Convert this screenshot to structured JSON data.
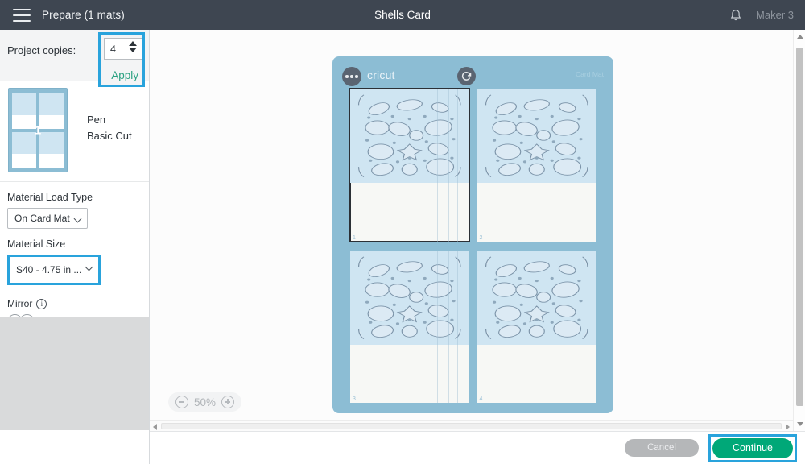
{
  "topbar": {
    "menu_icon": "hamburger-icon",
    "left_title": "Prepare (1 mats)",
    "center_title": "Shells Card",
    "bell_icon": "bell-icon",
    "machine_name": "Maker 3"
  },
  "sidebar": {
    "copies": {
      "label": "Project copies:",
      "value": "4",
      "apply_label": "Apply",
      "highlight_color": "#29a3dc"
    },
    "mat_thumbnail": {
      "number": "1",
      "operations": [
        "Pen",
        "Basic Cut"
      ]
    },
    "material_load_type": {
      "label": "Material Load Type",
      "value": "On Card Mat"
    },
    "material_size": {
      "label": "Material Size",
      "value": "S40 - 4.75 in ...",
      "highlight_color": "#29a3dc"
    },
    "mirror": {
      "label": "Mirror",
      "info_icon": "info-icon",
      "toggle_state": "off"
    }
  },
  "canvas": {
    "mat": {
      "more_icon": "more-options-icon",
      "brand": "cricut",
      "corner_label": "Card Mat",
      "rotate_icon": "rotate-icon",
      "cards": [
        {
          "number": "1",
          "selected": true
        },
        {
          "number": "2",
          "selected": false
        },
        {
          "number": "3",
          "selected": false
        },
        {
          "number": "4",
          "selected": false
        }
      ]
    },
    "zoom": {
      "minus_icon": "zoom-out-icon",
      "level": "50%",
      "plus_icon": "zoom-in-icon"
    }
  },
  "footer": {
    "cancel_label": "Cancel",
    "continue_label": "Continue",
    "continue_color": "#00a878",
    "highlight_color": "#29a3dc"
  }
}
